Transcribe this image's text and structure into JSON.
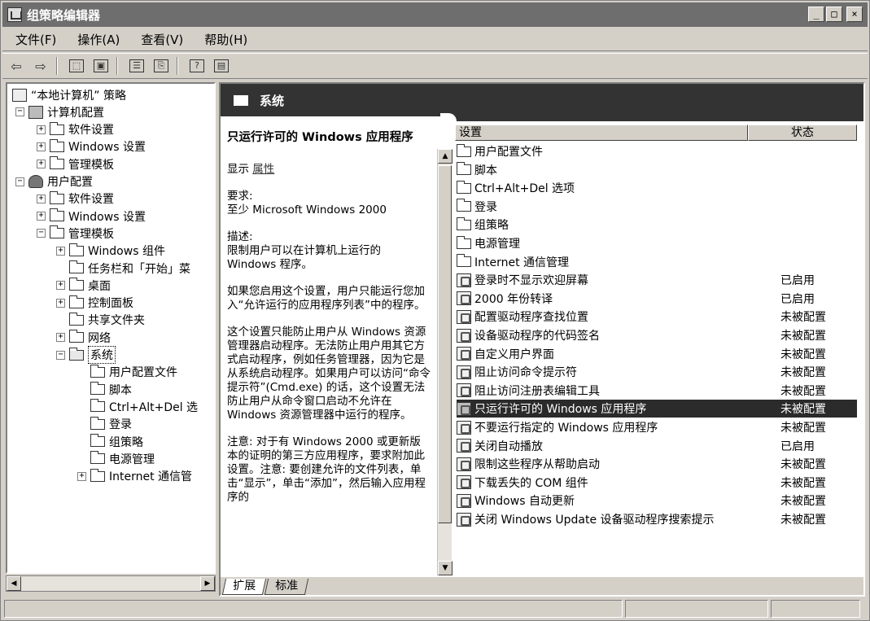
{
  "window": {
    "title": "组策略编辑器",
    "controls": [
      "_",
      "□",
      "×"
    ]
  },
  "menu": [
    "文件(F)",
    "操作(A)",
    "查看(V)",
    "帮助(H)"
  ],
  "toolbar": {
    "icons": [
      "back-arrow-icon",
      "forward-arrow-icon",
      "up-folder-icon",
      "show-tree-icon",
      "properties-icon",
      "export-list-icon",
      "help-icon",
      "console-icon"
    ],
    "glyphs": [
      "⇦",
      "⇨",
      "⬚",
      "▣",
      "☰",
      "⎘",
      "?",
      "▤"
    ]
  },
  "tree": [
    {
      "label": "“本地计算机” 策略",
      "icon": "policy",
      "depth": 0,
      "exp": ""
    },
    {
      "label": "计算机配置",
      "icon": "pc",
      "depth": 1,
      "exp": "−"
    },
    {
      "label": "软件设置",
      "icon": "folder",
      "depth": 2,
      "exp": "+"
    },
    {
      "label": "Windows 设置",
      "icon": "folder",
      "depth": 2,
      "exp": "+"
    },
    {
      "label": "管理模板",
      "icon": "folder",
      "depth": 2,
      "exp": "+"
    },
    {
      "label": "用户配置",
      "icon": "user",
      "depth": 1,
      "exp": "−"
    },
    {
      "label": "软件设置",
      "icon": "folder",
      "depth": 2,
      "exp": "+"
    },
    {
      "label": "Windows 设置",
      "icon": "folder",
      "depth": 2,
      "exp": "+"
    },
    {
      "label": "管理模板",
      "icon": "folder",
      "depth": 2,
      "exp": "−"
    },
    {
      "label": "Windows 组件",
      "icon": "folder",
      "depth": 3,
      "exp": "+"
    },
    {
      "label": "任务栏和「开始」菜",
      "icon": "folder",
      "depth": 3,
      "exp": ""
    },
    {
      "label": "桌面",
      "icon": "folder",
      "depth": 3,
      "exp": "+"
    },
    {
      "label": "控制面板",
      "icon": "folder",
      "depth": 3,
      "exp": "+"
    },
    {
      "label": "共享文件夹",
      "icon": "folder",
      "depth": 3,
      "exp": ""
    },
    {
      "label": "网络",
      "icon": "folder",
      "depth": 3,
      "exp": "+"
    },
    {
      "label": "系统",
      "icon": "folder-open",
      "depth": 3,
      "exp": "−",
      "selected": true
    },
    {
      "label": "用户配置文件",
      "icon": "folder",
      "depth": 4,
      "exp": ""
    },
    {
      "label": "脚本",
      "icon": "folder",
      "depth": 4,
      "exp": ""
    },
    {
      "label": "Ctrl+Alt+Del 选",
      "icon": "folder",
      "depth": 4,
      "exp": ""
    },
    {
      "label": "登录",
      "icon": "folder",
      "depth": 4,
      "exp": ""
    },
    {
      "label": "组策略",
      "icon": "folder",
      "depth": 4,
      "exp": ""
    },
    {
      "label": "电源管理",
      "icon": "folder",
      "depth": 4,
      "exp": ""
    },
    {
      "label": "Internet 通信管",
      "icon": "folder",
      "depth": 4,
      "exp": "+"
    }
  ],
  "header": {
    "title": "系统"
  },
  "desc": {
    "title": "只运行许可的 Windows 应用程序",
    "show": "显示",
    "props": "属性",
    "req_label": "要求:",
    "req_text": "至少 Microsoft Windows 2000",
    "desc_label": "描述:",
    "desc_text": "限制用户可以在计算机上运行的 Windows 程序。",
    "para1": "如果您启用这个设置，用户只能运行您加入“允许运行的应用程序列表”中的程序。",
    "para2": "这个设置只能防止用户从 Windows 资源管理器启动程序。无法防止用户用其它方式启动程序，例如任务管理器，因为它是从系统启动程序。如果用户可以访问“命令提示符”(Cmd.exe) 的话，这个设置无法防止用户从命令窗口启动不允许在 Windows 资源管理器中运行的程序。",
    "para3": "注意: 对于有 Windows 2000 或更新版本的证明的第三方应用程序，要求附加此设置。注意: 要创建允许的文件列表，单击“显示”，单击“添加”，然后输入应用程序的"
  },
  "list": {
    "col_setting": "设置",
    "col_state": "状态",
    "rows": [
      {
        "name": "用户配置文件",
        "state": "",
        "type": "folder"
      },
      {
        "name": "脚本",
        "state": "",
        "type": "folder"
      },
      {
        "name": "Ctrl+Alt+Del 选项",
        "state": "",
        "type": "folder"
      },
      {
        "name": "登录",
        "state": "",
        "type": "folder"
      },
      {
        "name": "组策略",
        "state": "",
        "type": "folder"
      },
      {
        "name": "电源管理",
        "state": "",
        "type": "folder"
      },
      {
        "name": "Internet 通信管理",
        "state": "",
        "type": "folder"
      },
      {
        "name": "登录时不显示欢迎屏幕",
        "state": "已启用",
        "type": "setting"
      },
      {
        "name": "2000 年份转译",
        "state": "已启用",
        "type": "setting"
      },
      {
        "name": "配置驱动程序查找位置",
        "state": "未被配置",
        "type": "setting"
      },
      {
        "name": "设备驱动程序的代码签名",
        "state": "未被配置",
        "type": "setting"
      },
      {
        "name": "自定义用户界面",
        "state": "未被配置",
        "type": "setting"
      },
      {
        "name": "阻止访问命令提示符",
        "state": "未被配置",
        "type": "setting"
      },
      {
        "name": "阻止访问注册表编辑工具",
        "state": "未被配置",
        "type": "setting"
      },
      {
        "name": "只运行许可的 Windows 应用程序",
        "state": "未被配置",
        "type": "setting",
        "selected": true
      },
      {
        "name": "不要运行指定的 Windows 应用程序",
        "state": "未被配置",
        "type": "setting"
      },
      {
        "name": "关闭自动播放",
        "state": "已启用",
        "type": "setting"
      },
      {
        "name": "限制这些程序从帮助启动",
        "state": "未被配置",
        "type": "setting"
      },
      {
        "name": "下载丢失的 COM 组件",
        "state": "未被配置",
        "type": "setting"
      },
      {
        "name": "Windows 自动更新",
        "state": "未被配置",
        "type": "setting"
      },
      {
        "name": "关闭 Windows Update 设备驱动程序搜索提示",
        "state": "未被配置",
        "type": "setting"
      }
    ]
  },
  "tabs": [
    {
      "label": "扩展",
      "active": true
    },
    {
      "label": "标准",
      "active": false
    }
  ],
  "scroll": {
    "left": "◀",
    "right": "▶",
    "up": "▲",
    "down": "▼"
  }
}
